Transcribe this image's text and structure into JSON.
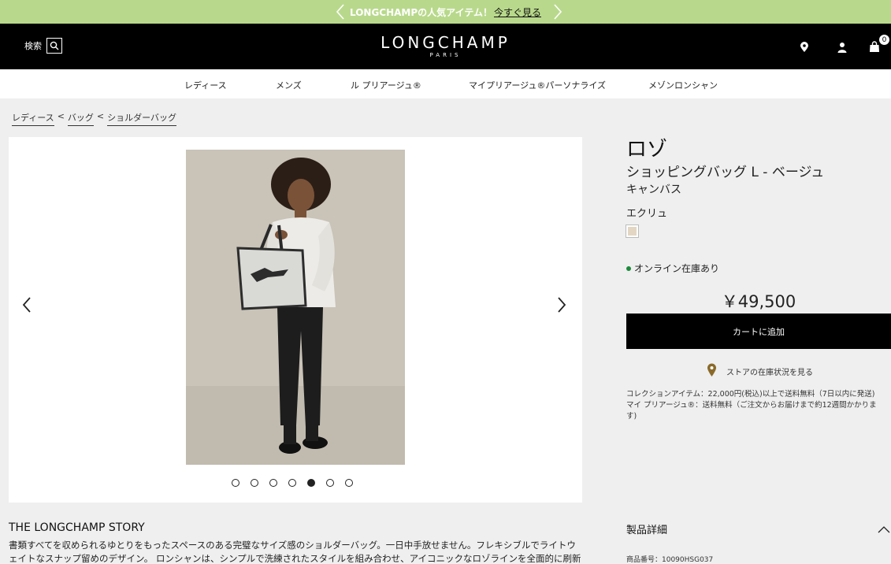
{
  "promo": {
    "message": "LONGCHAMPの人気アイテム！",
    "link": "今すぐ見る"
  },
  "header": {
    "search_label": "検索",
    "logo": "LONGCHAMP",
    "logo_sub": "PARIS",
    "cart_count": "0"
  },
  "nav": {
    "items": [
      "レディース",
      "メンズ",
      "ル プリアージュ®",
      "マイプリアージュ®パーソナライズ",
      "メゾンロンシャン"
    ]
  },
  "breadcrumb": {
    "items": [
      "レディース",
      "バッグ",
      "ショルダーバッグ"
    ],
    "separator": "<"
  },
  "product": {
    "name": "ロゾ",
    "subtitle": "ショッピングバッグ L - ベージュ",
    "material": "キャンバス",
    "color_name": "エクリュ",
    "swatch_color": "#e3d6c3",
    "stock": "オンライン在庫あり",
    "price": "￥49,500",
    "add_to_cart": "カートに追加",
    "store_check": "ストアの在庫状況を見る",
    "shipping_line1": "コレクションアイテム：22,000円(税込)以上で送料無料（7日以内に発送)",
    "shipping_line2": "マイ プリアージュ®：送料無料（ご注文からお届けまで約12週間かかります)"
  },
  "gallery": {
    "image_count": 7,
    "active_index": 4
  },
  "story": {
    "title": "THE LONGCHAMP STORY",
    "text": "書類すべてを収められるゆとりをもったスペースのある完璧なサイズ感のショルダーバッグ。一日中手放せません。フレキシブルでライトウェイトなスナップ留めのデザイン。 ロンシャンは、シンプルで洗練されたスタイルを組み合わせ、アイコニックなロゾラインを全面的に刷新しまし"
  },
  "details": {
    "title": "製品詳細",
    "sku": "商品番号：10090HSG037"
  },
  "colors": {
    "promo_bg": "#b8d98b",
    "header_bg": "#000000",
    "stock_dot": "#1a8a3a",
    "store_pin": "#8a6a2a"
  }
}
